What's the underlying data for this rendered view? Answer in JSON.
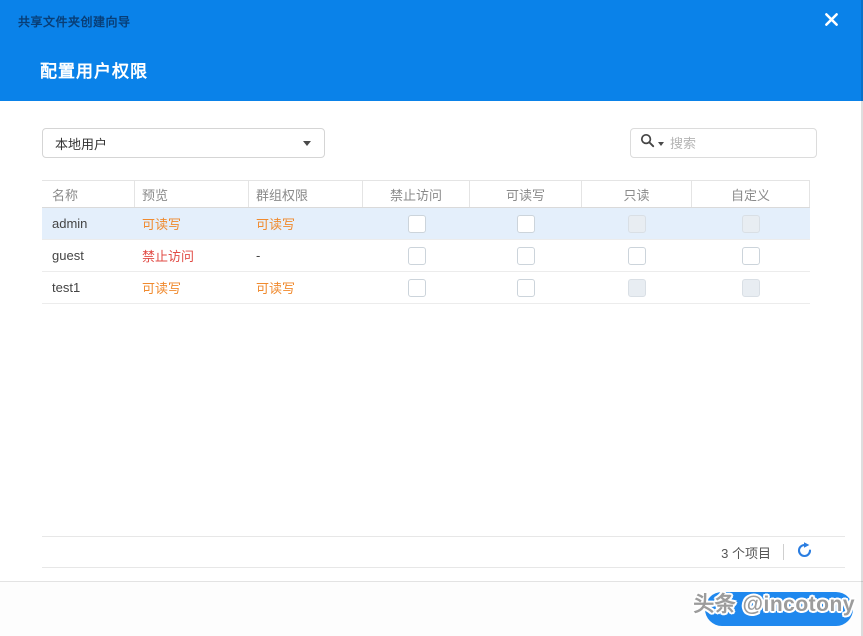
{
  "dialog": {
    "wizard_title": "共享文件夹创建向导",
    "step_title": "配置用户权限"
  },
  "toolbar": {
    "user_type_selected": "本地用户",
    "search_placeholder": "搜索"
  },
  "table": {
    "columns": [
      "名称",
      "预览",
      "群组权限",
      "禁止访问",
      "可读写",
      "只读",
      "自定义"
    ],
    "rows": [
      {
        "name": "admin",
        "preview": "可读写",
        "group_permission": "可读写",
        "selected": true,
        "checkboxes": {
          "no_access": {
            "checked": false,
            "disabled": false
          },
          "read_write": {
            "checked": false,
            "disabled": false
          },
          "read_only": {
            "checked": false,
            "disabled": true
          },
          "custom": {
            "checked": false,
            "disabled": true
          }
        }
      },
      {
        "name": "guest",
        "preview": "禁止访问",
        "group_permission": "-",
        "selected": false,
        "checkboxes": {
          "no_access": {
            "checked": false,
            "disabled": false
          },
          "read_write": {
            "checked": false,
            "disabled": false
          },
          "read_only": {
            "checked": false,
            "disabled": false
          },
          "custom": {
            "checked": false,
            "disabled": false
          }
        }
      },
      {
        "name": "test1",
        "preview": "可读写",
        "group_permission": "可读写",
        "selected": false,
        "checkboxes": {
          "no_access": {
            "checked": false,
            "disabled": false
          },
          "read_write": {
            "checked": false,
            "disabled": false
          },
          "read_only": {
            "checked": false,
            "disabled": true
          },
          "custom": {
            "checked": false,
            "disabled": true
          }
        }
      }
    ]
  },
  "statusbar": {
    "item_count": "3 个项目"
  },
  "footer": {
    "watermark": "头条 @incotony"
  },
  "colors": {
    "header_blue": "#0a82e9",
    "button_blue": "#1f88ee",
    "refresh_blue": "#2a7de1",
    "permission_orange": "#f08a2e",
    "permission_red": "#e14b45",
    "row_highlight": "#e4effb"
  }
}
